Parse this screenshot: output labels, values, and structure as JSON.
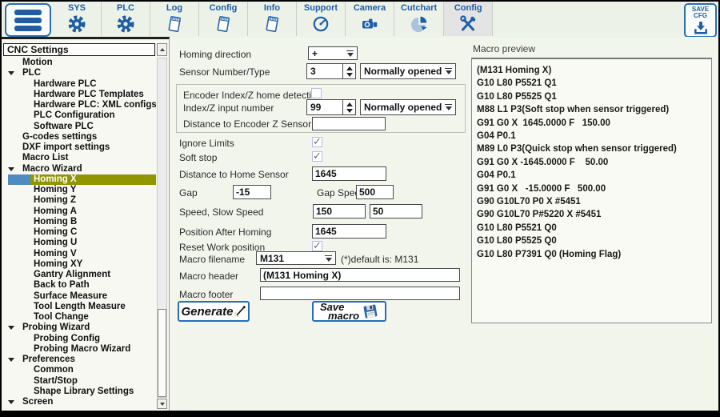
{
  "toolbar": {
    "tabs": [
      {
        "label": "SYS",
        "icon": "#icon-gear",
        "icon_name": "gear-icon"
      },
      {
        "label": "PLC",
        "icon": "#icon-gear",
        "icon_name": "gear-icon"
      },
      {
        "label": "Log",
        "icon": "#icon-notebook",
        "icon_name": "notebook-icon"
      },
      {
        "label": "Config",
        "icon": "#icon-notebook",
        "icon_name": "notebook-icon"
      },
      {
        "label": "Info",
        "icon": "#icon-notebook",
        "icon_name": "notebook-icon"
      },
      {
        "label": "Support",
        "icon": "#icon-dial",
        "icon_name": "dial-icon"
      },
      {
        "label": "Camera",
        "icon": "#icon-camera",
        "icon_name": "camera-icon"
      },
      {
        "label": "Cutchart",
        "icon": "#icon-pie",
        "icon_name": "pie-chart-icon"
      },
      {
        "label": "Config",
        "icon": "#icon-tools",
        "icon_name": "tools-icon",
        "classes": "active"
      }
    ],
    "save_cfg": {
      "line1": "SAVE",
      "line2": "CFG"
    }
  },
  "sidebar": {
    "header": "CNC Settings",
    "items": [
      {
        "label": "Motion",
        "classes": "lvl0"
      },
      {
        "label": "PLC",
        "classes": "lvl0 group"
      },
      {
        "label": "Hardware PLC",
        "classes": "lvl1"
      },
      {
        "label": "Hardware PLC Templates",
        "classes": "lvl1"
      },
      {
        "label": "Hardware PLC: XML configs",
        "classes": "lvl1"
      },
      {
        "label": "PLC Configuration",
        "classes": "lvl1"
      },
      {
        "label": "Software PLC",
        "classes": "lvl1"
      },
      {
        "label": "G-codes settings",
        "classes": "lvl0"
      },
      {
        "label": "DXF import settings",
        "classes": "lvl0"
      },
      {
        "label": "Macro List",
        "classes": "lvl0"
      },
      {
        "label": "Macro Wizard",
        "classes": "lvl0 group"
      },
      {
        "label": "Homing X",
        "classes": "lvl1 selected"
      },
      {
        "label": "Homing Y",
        "classes": "lvl1"
      },
      {
        "label": "Homing Z",
        "classes": "lvl1"
      },
      {
        "label": "Homing A",
        "classes": "lvl1"
      },
      {
        "label": "Homing B",
        "classes": "lvl1"
      },
      {
        "label": "Homing C",
        "classes": "lvl1"
      },
      {
        "label": "Homing U",
        "classes": "lvl1"
      },
      {
        "label": "Homing V",
        "classes": "lvl1"
      },
      {
        "label": "Homing XY",
        "classes": "lvl1"
      },
      {
        "label": "Gantry Alignment",
        "classes": "lvl1"
      },
      {
        "label": "Back to Path",
        "classes": "lvl1"
      },
      {
        "label": "Surface Measure",
        "classes": "lvl1"
      },
      {
        "label": "Tool Length Measure",
        "classes": "lvl1"
      },
      {
        "label": "Tool Change",
        "classes": "lvl1"
      },
      {
        "label": "Probing Wizard",
        "classes": "lvl0 group"
      },
      {
        "label": "Probing Config",
        "classes": "lvl1"
      },
      {
        "label": "Probing Macro Wizard",
        "classes": "lvl1"
      },
      {
        "label": "Preferences",
        "classes": "lvl0 group"
      },
      {
        "label": "Common",
        "classes": "lvl1"
      },
      {
        "label": "Start/Stop",
        "classes": "lvl1"
      },
      {
        "label": "Shape Library Settings",
        "classes": "lvl1"
      },
      {
        "label": "Screen",
        "classes": "lvl0 group"
      }
    ]
  },
  "form": {
    "homing_direction": {
      "label": "Homing direction",
      "value": "+"
    },
    "sensor": {
      "label": "Sensor Number/Type",
      "number": "3",
      "type": "Normally opened"
    },
    "encoder": {
      "detect_label": "Encoder Index/Z home detection",
      "detect_check": "",
      "input_label": "Index/Z input number",
      "input_number": "99",
      "input_type": "Normally opened",
      "distance_label": "Distance to Encoder Z Sensor",
      "distance_value": ""
    },
    "ignore_limits": {
      "label": "Ignore Limits",
      "check": "✓"
    },
    "soft_stop": {
      "label": "Soft stop",
      "check": "✓"
    },
    "distance_home": {
      "label": "Distance to Home Sensor",
      "value": "1645"
    },
    "gap": {
      "label": "Gap",
      "value": "-15",
      "speed_label": "Gap Speed",
      "speed_value": "500"
    },
    "speed": {
      "label": "Speed, Slow Speed",
      "speed": "150",
      "slow": "50"
    },
    "position_after": {
      "label": "Position After Homing",
      "value": "1645"
    },
    "reset_work": {
      "label": "Reset Work position",
      "check": "✓"
    },
    "macro_filename": {
      "label": "Macro filename",
      "value": "M131",
      "hint": "(*)default is: M131"
    },
    "macro_header": {
      "label": "Macro header",
      "value": "(M131 Homing X)"
    },
    "macro_footer": {
      "label": "Macro footer",
      "value": ""
    },
    "generate_label": "Generate",
    "save_macro_line1": "Save",
    "save_macro_line2": "macro"
  },
  "preview": {
    "label": "Macro preview",
    "lines": [
      "(M131 Homing X)",
      "G10 L80 P5521 Q1",
      "G10 L80 P5525 Q1",
      "M88 L1 P3(Soft stop when sensor triggered)",
      "G91 G0 X  1645.0000 F   150.00",
      "G04 P0.1",
      "M89 L0 P3(Quick stop when sensor triggered)",
      "G91 G0 X -1645.0000 F    50.00",
      "G04 P0.1",
      "G91 G0 X   -15.0000 F   500.00",
      "G90 G10L70 P0 X #5451",
      "G90 G10L70 P#5220 X #5451",
      "G10 L80 P5521 Q0",
      "G10 L80 P5525 Q0",
      "G10 L80 P7391 Q0 (Homing Flag)"
    ]
  }
}
